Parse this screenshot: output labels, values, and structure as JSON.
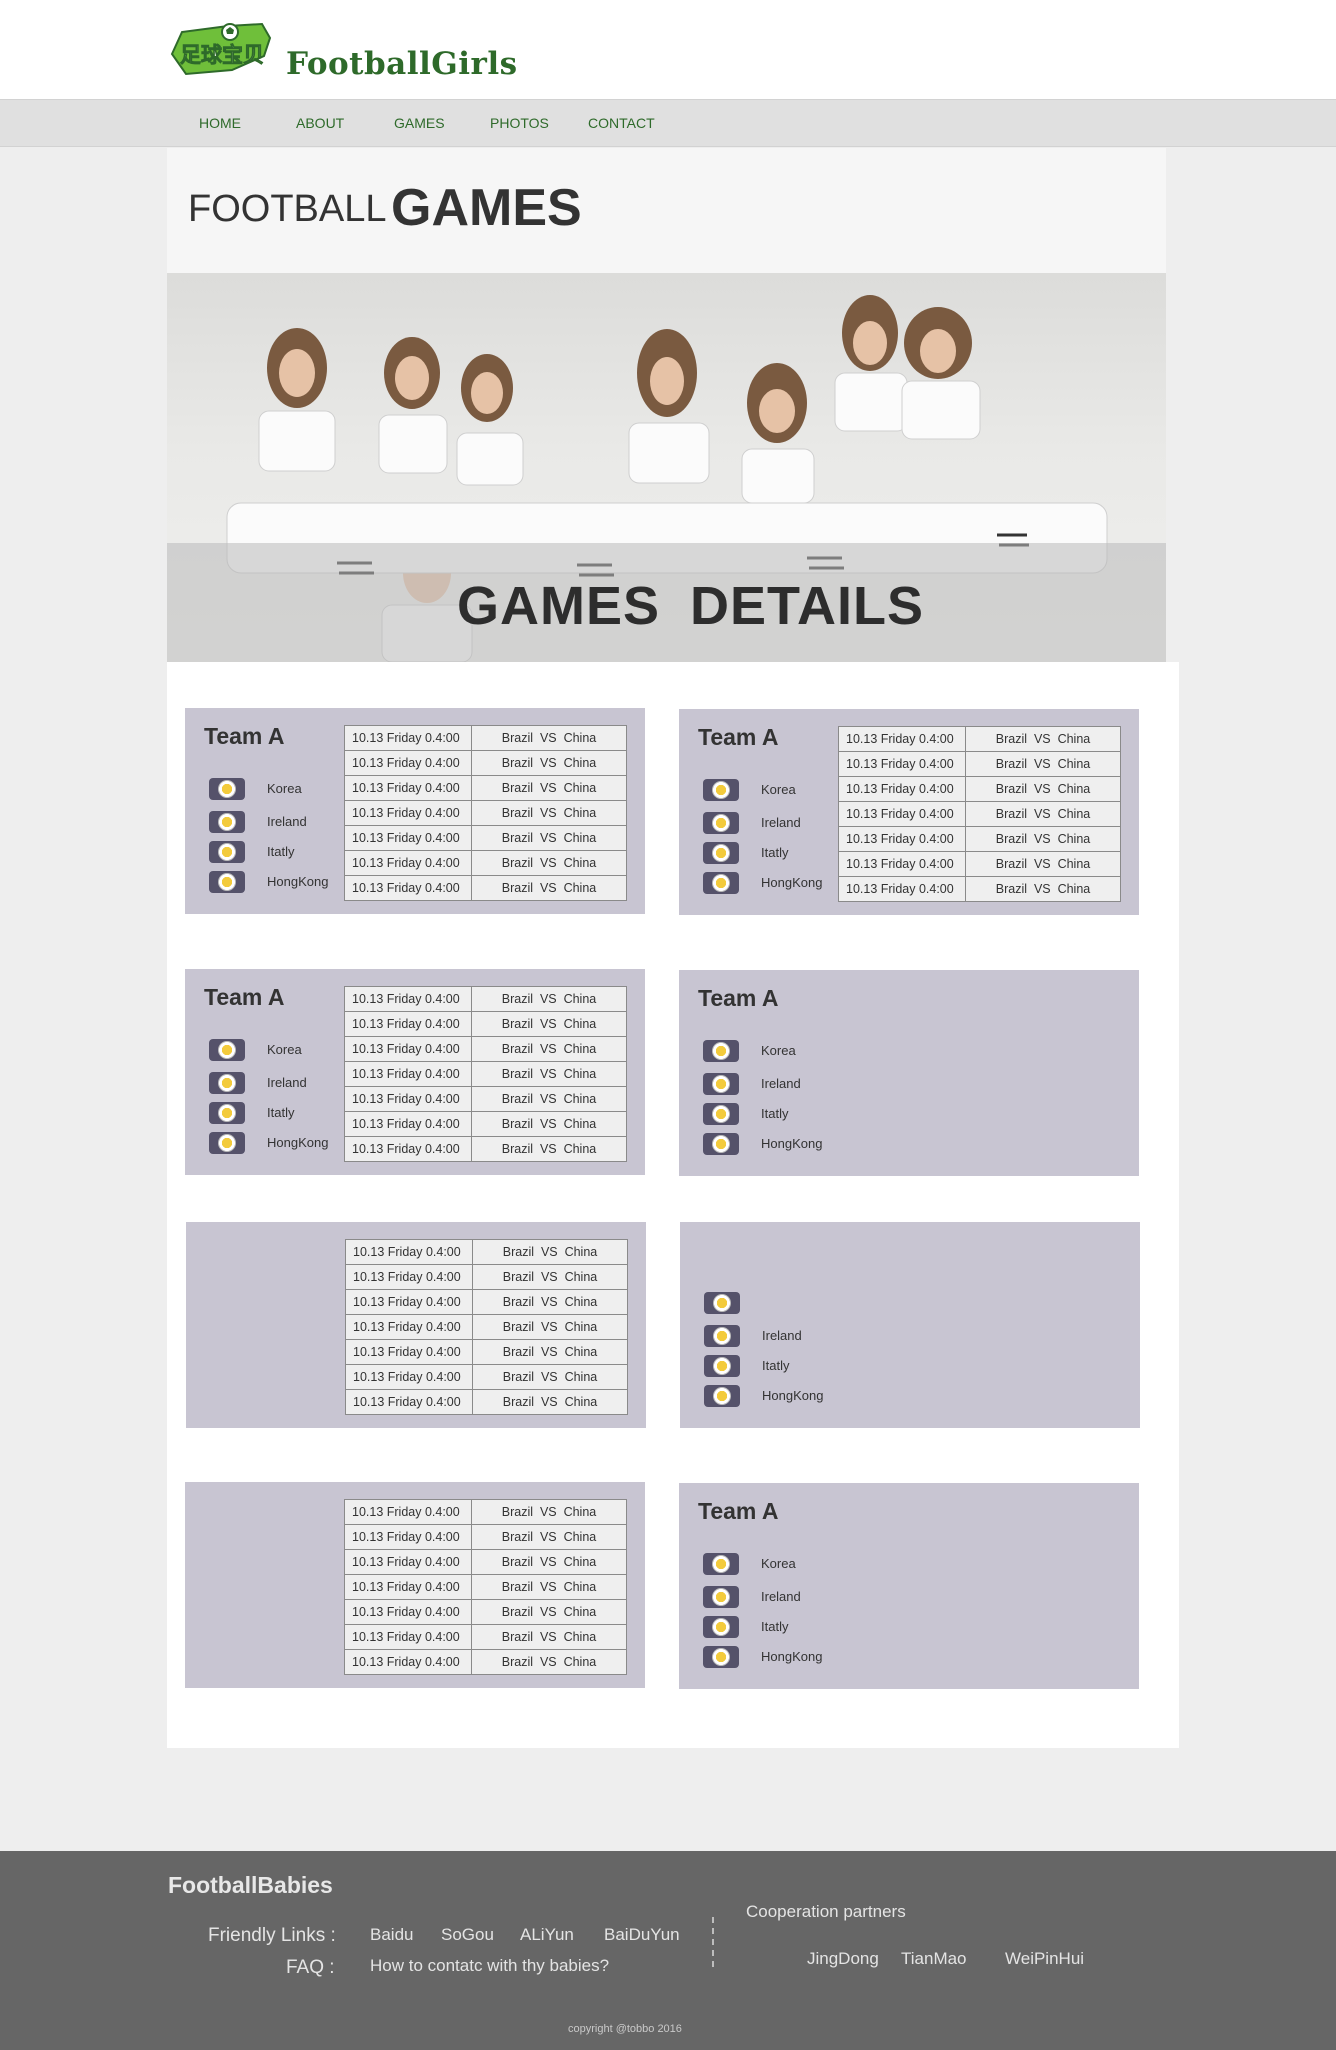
{
  "header": {
    "logo_badge_text": "足球宝贝",
    "logo_text": "FootballGirls"
  },
  "nav": {
    "items": [
      "HOME",
      "ABOUT",
      "GAMES",
      "PHOTOS",
      "CONTACT"
    ]
  },
  "title": {
    "small": "FOOTBALL",
    "big": "GAMES"
  },
  "banner": {
    "title": "GAMES DETAILS"
  },
  "teams": {
    "title": "Team A",
    "names": [
      "Korea",
      "Ireland",
      "Itatly",
      "HongKong"
    ]
  },
  "schedule": {
    "time": "10.13 Friday 0.4:00",
    "match": "Brazil  VS  China",
    "rows": 7
  },
  "footer": {
    "brand": "FootballBabies",
    "friendly_label": "Friendly Links :",
    "links": [
      "Baidu",
      "SoGou",
      "ALiYun",
      "BaiDuYun"
    ],
    "faq_label": "FAQ :",
    "faq_text": "How to contatc with thy babies?",
    "coop_title": "Cooperation partners",
    "partners": [
      "JingDong",
      "TianMao",
      "WeiPinHui"
    ],
    "copyright": "copyright @tobbo 2016"
  },
  "colors": {
    "brand_green": "#2e6a2a",
    "card_bg": "#c8c5d2",
    "footer_bg": "#666666",
    "page_bg": "#eeeeee"
  }
}
